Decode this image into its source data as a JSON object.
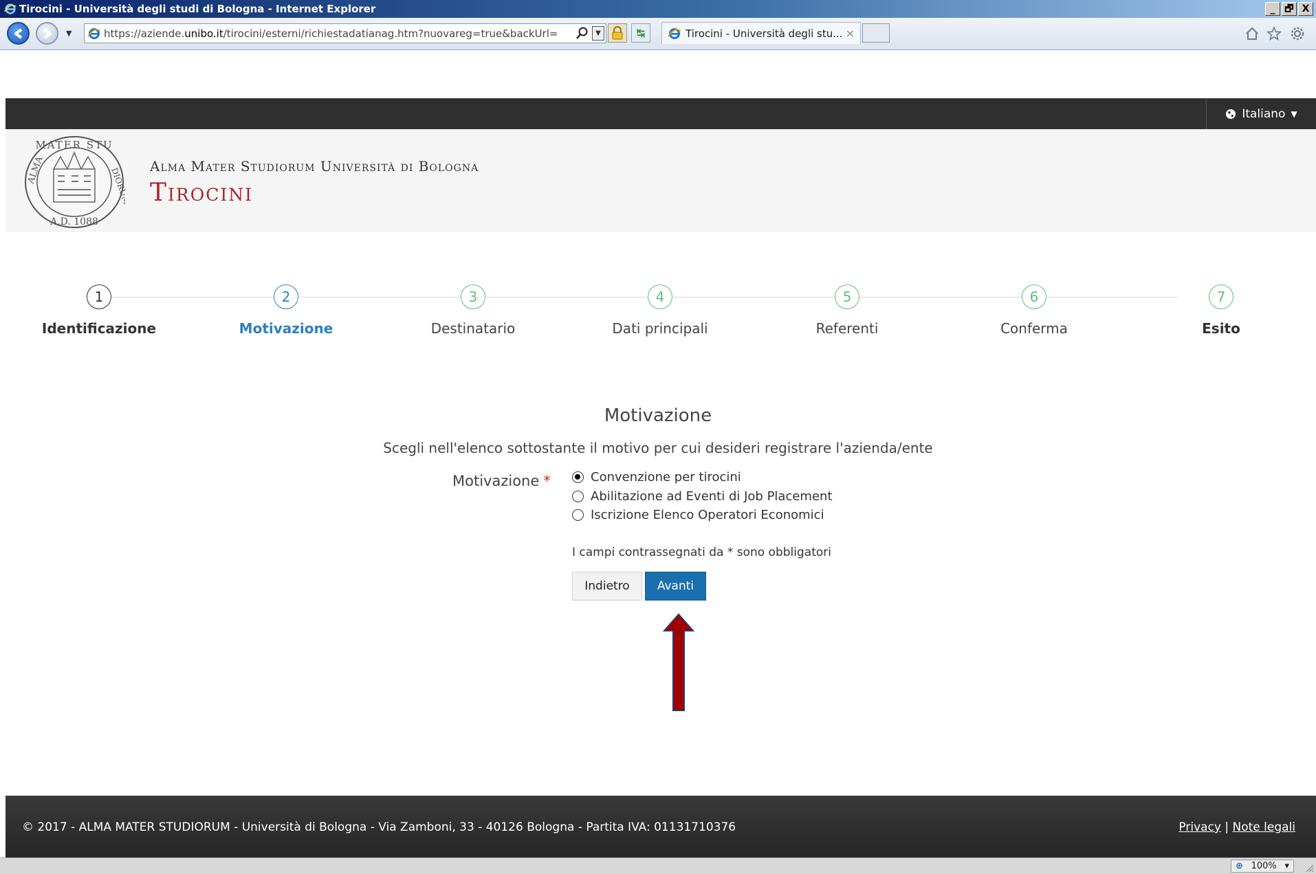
{
  "browser": {
    "window_title": "Tirocini - Università degli studi di Bologna - Internet Explorer",
    "window_buttons": [
      "_",
      "🗗",
      "X"
    ],
    "address_url_prefix": "https://aziende.",
    "address_url_host": "unibo.it",
    "address_url_path": "/tirocini/esterni/richiestadatianag.htm?nuovareg=true&backUrl=../wı",
    "tab_title": "Tirocini - Università degli stu...",
    "tab_close": "×",
    "zoom_level": "100%",
    "zoom_caret": "▾",
    "history_caret": "▼",
    "refresh_glyph": "↹"
  },
  "topbar": {
    "language_label": "Italiano",
    "language_caret": "▼"
  },
  "header": {
    "university_name": "Alma Mater Studiorum Università di Bologna",
    "app_name": "Tirocini"
  },
  "stepper": {
    "steps": [
      {
        "number": "1",
        "label": "Identificazione",
        "state": "done"
      },
      {
        "number": "2",
        "label": "Motivazione",
        "state": "active"
      },
      {
        "number": "3",
        "label": "Destinatario",
        "state": "todo"
      },
      {
        "number": "4",
        "label": "Dati principali",
        "state": "todo"
      },
      {
        "number": "5",
        "label": "Referenti",
        "state": "todo"
      },
      {
        "number": "6",
        "label": "Conferma",
        "state": "todo"
      },
      {
        "number": "7",
        "label": "Esito",
        "state": "todo"
      }
    ]
  },
  "form": {
    "title": "Motivazione",
    "subtitle": "Scegli nell'elenco sottostante il motivo per cui desideri registrare l'azienda/ente",
    "field_label": "Motivazione",
    "required_mark": "*",
    "options": [
      {
        "label": "Convenzione per tirocini",
        "selected": true
      },
      {
        "label": "Abilitazione ad Eventi di Job Placement",
        "selected": false
      },
      {
        "label": "Iscrizione Elenco Operatori Economici",
        "selected": false
      }
    ],
    "required_note": "I campi contrassegnati da * sono obbligatori",
    "back_button": "Indietro",
    "next_button": "Avanti"
  },
  "footer": {
    "copyright": "© 2017 - ALMA MATER STUDIORUM - Università di Bologna - Via Zamboni, 33 - 40126 Bologna - Partita IVA: 01131710376",
    "privacy_link": "Privacy",
    "separator": "|",
    "legal_link": "Note legali"
  },
  "colors": {
    "brand_red": "#a8262b",
    "primary_blue": "#1b6fae",
    "step_done": "#333333",
    "step_active": "#2f7fc1",
    "step_todo": "#63bf79",
    "annotation_arrow": "#a00000"
  },
  "icons": {
    "browser_logo": "ie-logo-icon",
    "back": "back-arrow-icon",
    "forward": "forward-arrow-icon",
    "search": "search-icon",
    "lock": "lock-icon",
    "home": "home-icon",
    "favorites": "star-icon",
    "tools": "gear-icon",
    "language": "globe-icon",
    "seal": "university-seal-icon"
  }
}
